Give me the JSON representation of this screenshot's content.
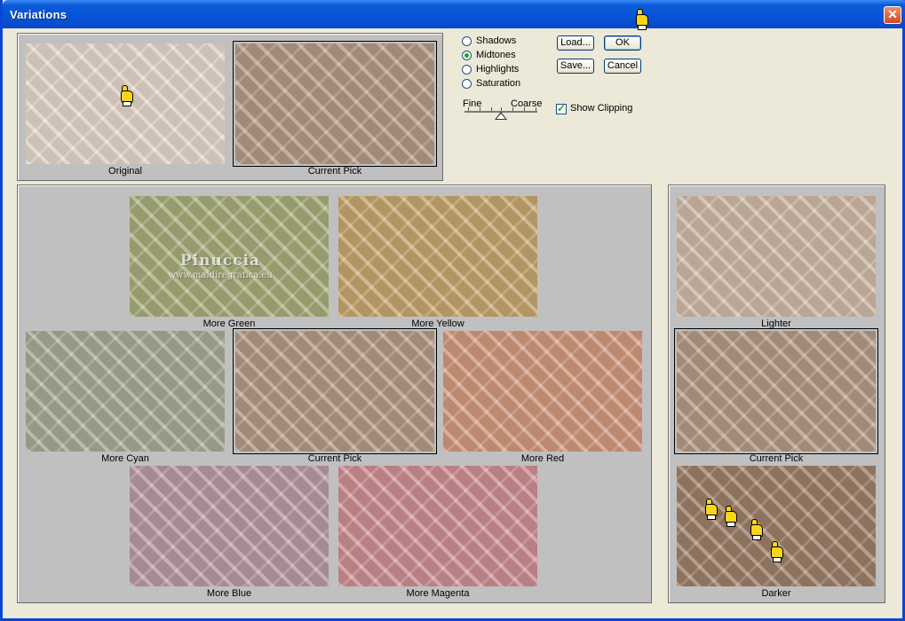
{
  "window": {
    "title": "Variations",
    "close_glyph": "✕"
  },
  "previews": {
    "original_label": "Original",
    "current_pick_label": "Current Pick"
  },
  "tones": [
    {
      "label": "Shadows",
      "selected": false
    },
    {
      "label": "Midtones",
      "selected": true
    },
    {
      "label": "Highlights",
      "selected": false
    },
    {
      "label": "Saturation",
      "selected": false
    }
  ],
  "buttons": {
    "load": "Load...",
    "save": "Save...",
    "ok": "OK",
    "cancel": "Cancel"
  },
  "slider": {
    "fine_label": "Fine",
    "coarse_label": "Coarse"
  },
  "show_clipping": {
    "label": "Show Clipping",
    "checked": true
  },
  "color_variations": {
    "more_green": "More Green",
    "more_yellow": "More Yellow",
    "more_cyan": "More Cyan",
    "current_pick": "Current Pick",
    "more_red": "More Red",
    "more_blue": "More Blue",
    "more_magenta": "More Magenta"
  },
  "brightness": {
    "lighter": "Lighter",
    "current_pick": "Current Pick",
    "darker": "Darker"
  },
  "watermark": {
    "name": "Pinuccia",
    "url": "www.maidiregrafica.eu"
  },
  "icons": {
    "pointer": "pointing-hand-icon",
    "close": "close-icon",
    "check": "checkmark-icon"
  }
}
